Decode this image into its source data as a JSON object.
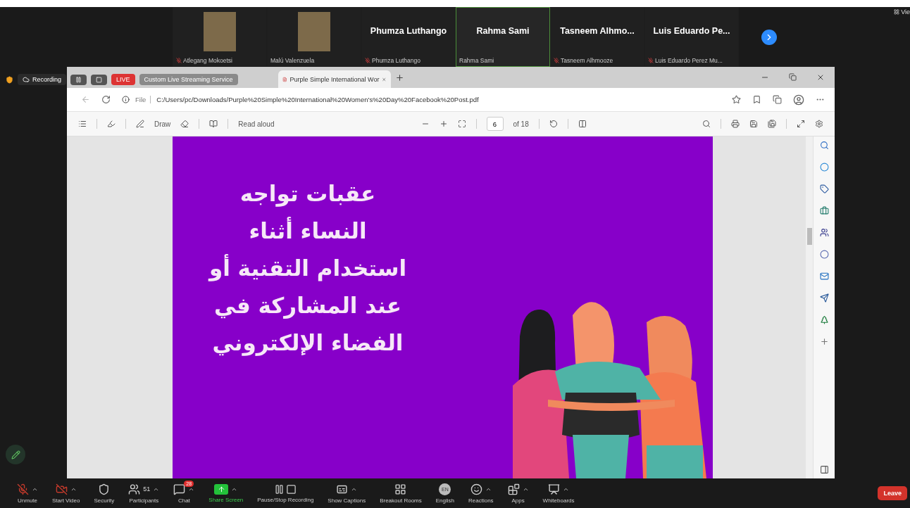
{
  "gallery": {
    "tiles": [
      {
        "kind": "photo",
        "label": "Atlegang Mokoetsi",
        "muted": true,
        "speaking": false
      },
      {
        "kind": "photo",
        "label": "Malú Valenzuela",
        "muted": false,
        "speaking": false
      },
      {
        "kind": "name",
        "name": "Phumza Luthango",
        "label": "Phumza Luthango",
        "muted": true,
        "speaking": false
      },
      {
        "kind": "name",
        "name": "Rahma Sami",
        "label": "Rahma Sami",
        "muted": false,
        "speaking": true
      },
      {
        "kind": "name",
        "name": "Tasneem  Alhmo...",
        "label": "Tasneem Alhmooze",
        "muted": true,
        "speaking": false
      },
      {
        "kind": "name",
        "name": "Luis Eduardo Pe...",
        "label": "Luis Eduardo Perez Mu...",
        "muted": true,
        "speaking": false
      }
    ],
    "view_button": "Vie"
  },
  "recording_bar": {
    "recording": "Recording",
    "live": "LIVE",
    "service": "Custom Live Streaming Service"
  },
  "browser": {
    "tabs": [
      {
        "title": "Purple Simple International Wor",
        "selected": true
      }
    ],
    "address_prefix": "File",
    "address": "C:/Users/pc/Downloads/Purple%20Simple%20International%20Women's%20Day%20Facebook%20Post.pdf",
    "pdf_toolbar": {
      "draw": "Draw",
      "read_aloud": "Read aloud",
      "page": "6",
      "page_count": "of 18"
    }
  },
  "slide": {
    "lines": [
      "عقبات تواجه",
      "النساء أثناء",
      "استخدام التقنية أو",
      "عند المشاركة في",
      "الفضاء الإلكتروني"
    ]
  },
  "toolbar": {
    "items": [
      {
        "kind": "button",
        "label": "Unmute",
        "menu": true
      },
      {
        "kind": "button",
        "label": "Start Video",
        "menu": true
      },
      {
        "kind": "button",
        "label": "Security",
        "menu": false
      },
      {
        "kind": "button",
        "label": "Participants",
        "count": "51",
        "menu": true
      },
      {
        "kind": "button",
        "label": "Chat",
        "badge": "28",
        "menu": true
      },
      {
        "kind": "share",
        "label": "Share Screen",
        "menu": true
      },
      {
        "kind": "button",
        "label": "Pause/Stop Recording",
        "menu": false
      },
      {
        "kind": "button",
        "label": "Show Captions",
        "menu": true
      },
      {
        "kind": "button",
        "label": "Breakout Rooms",
        "menu": false
      },
      {
        "kind": "button",
        "label": "English",
        "icon_text": "EN",
        "menu": false
      },
      {
        "kind": "button",
        "label": "Reactions",
        "menu": true
      },
      {
        "kind": "button",
        "label": "Apps",
        "menu": true
      },
      {
        "kind": "button",
        "label": "Whiteboards",
        "menu": true
      }
    ],
    "leave": "Leave"
  }
}
